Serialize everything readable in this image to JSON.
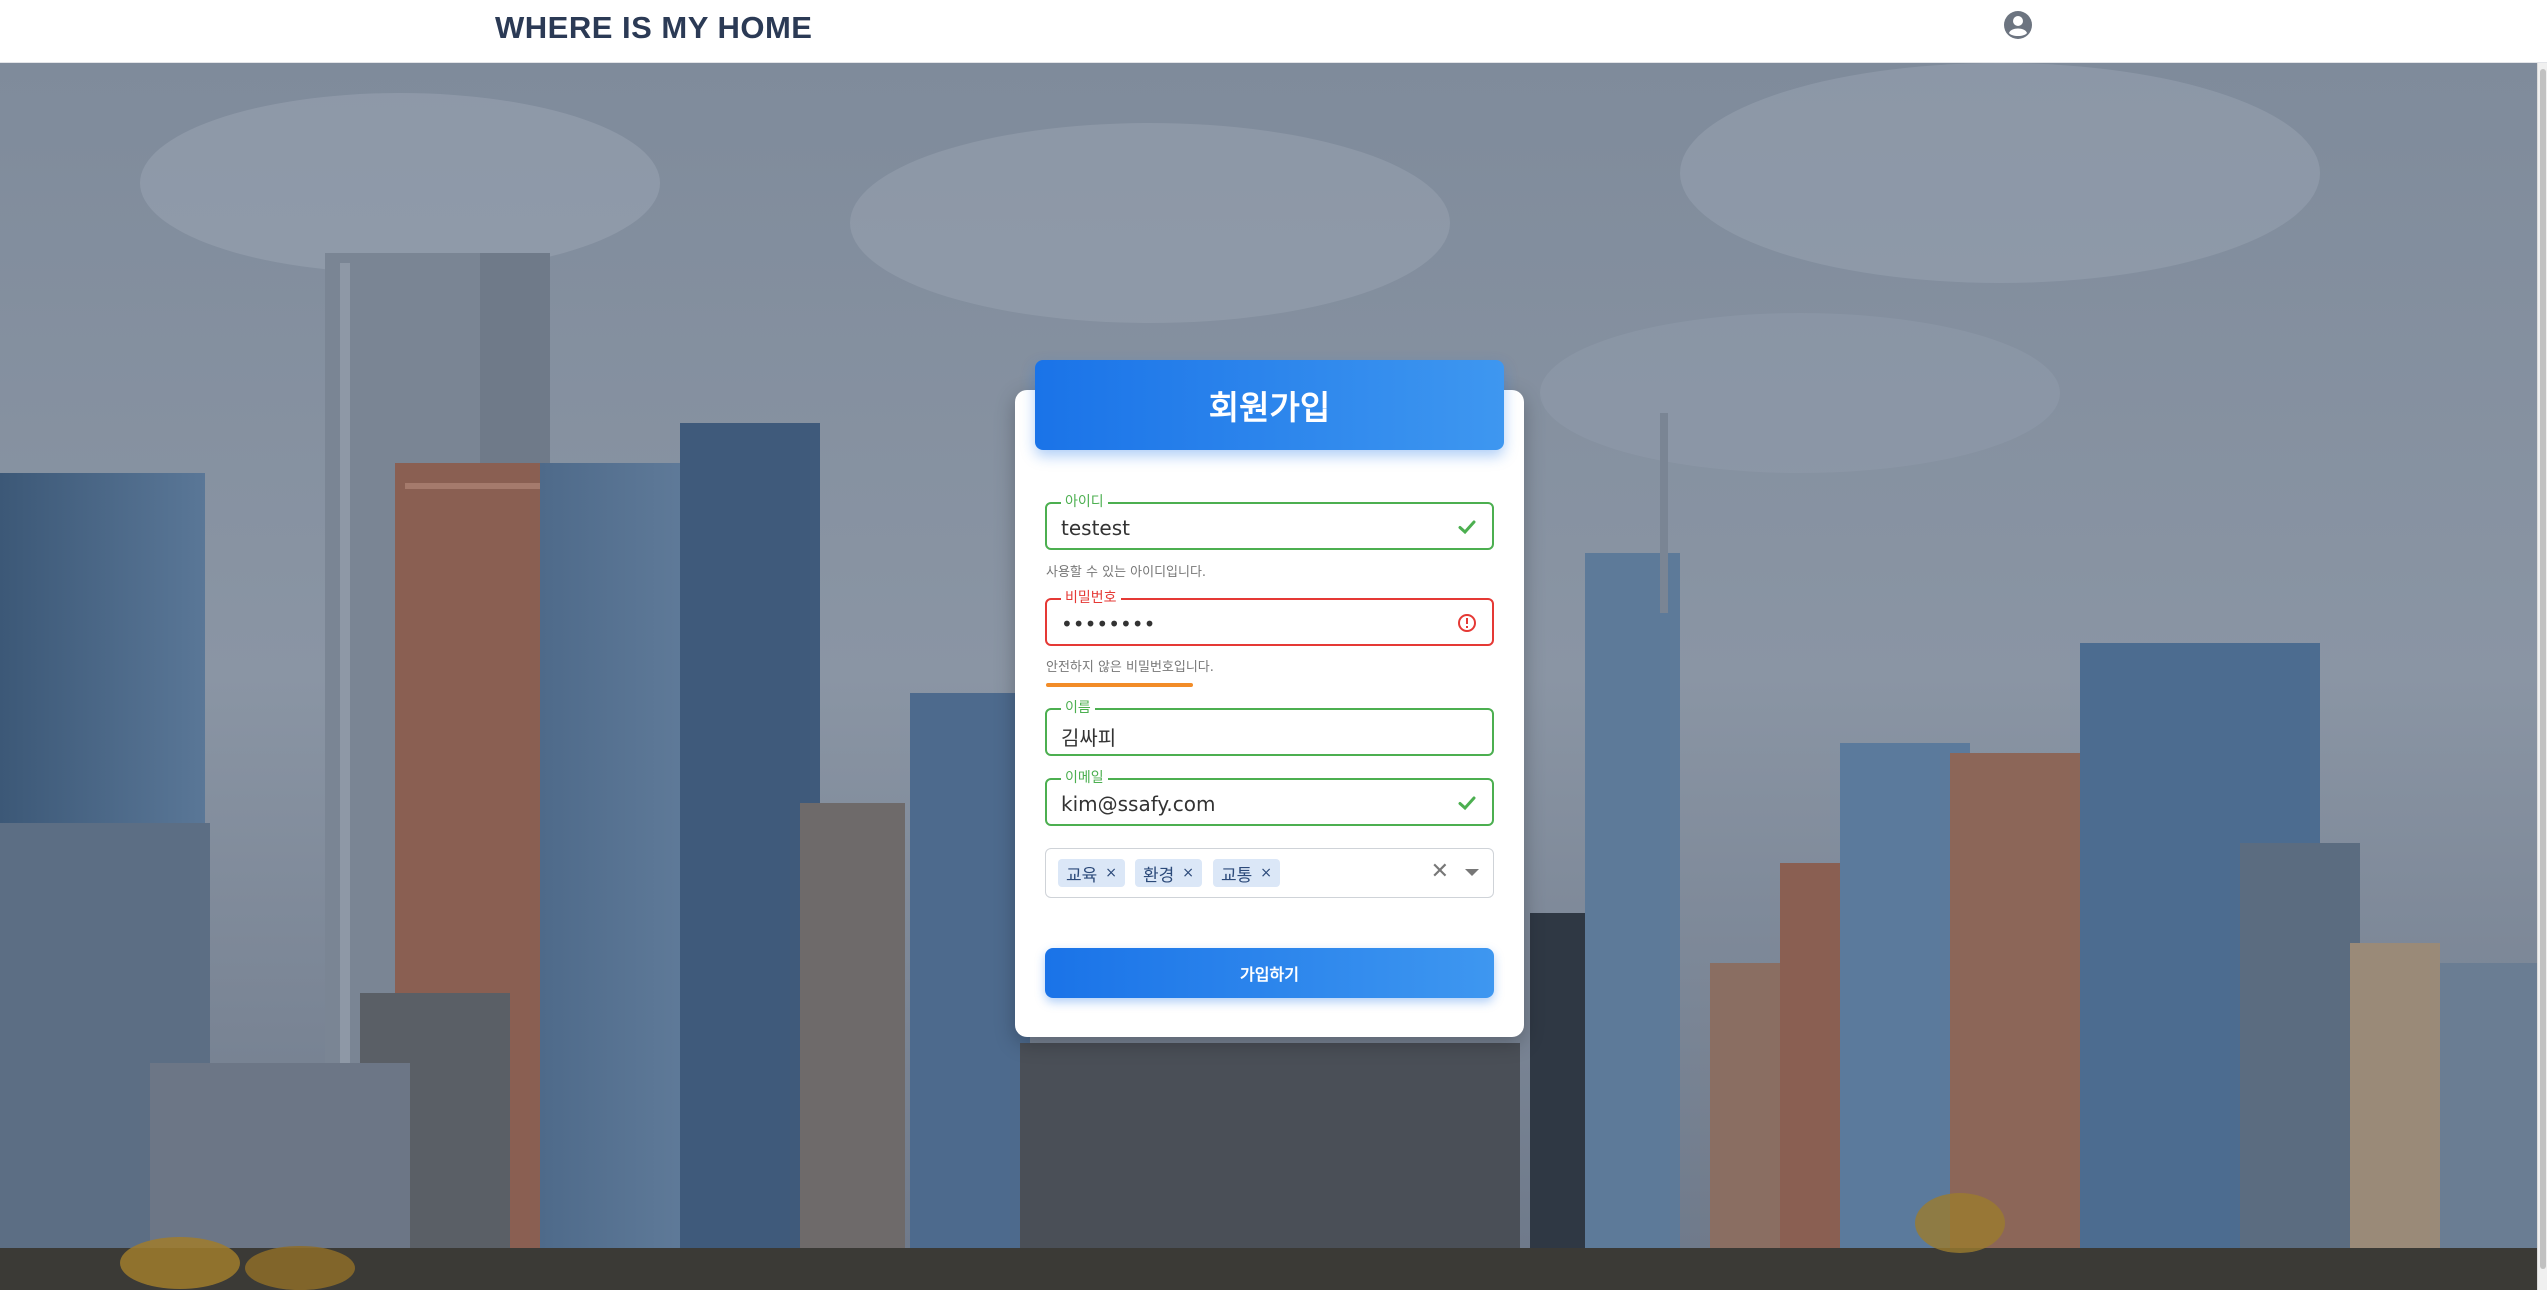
{
  "nav": {
    "brand": "WHERE IS MY HOME",
    "account_icon": "account-circle-icon"
  },
  "signup": {
    "title": "회원가입",
    "fields": {
      "id": {
        "label": "아이디",
        "value": "testest",
        "helper": "사용할 수 있는 아이디입니다.",
        "status": "valid"
      },
      "password": {
        "label": "비밀번호",
        "value": "••••••••",
        "helper": "안전하지 않은 비밀번호입니다.",
        "status": "error"
      },
      "name": {
        "label": "이름",
        "value": "김싸피",
        "status": "valid"
      },
      "email": {
        "label": "이메일",
        "value": "kim@ssafy.com",
        "status": "valid"
      }
    },
    "interests": {
      "tags": [
        "교육",
        "환경",
        "교통"
      ],
      "remove_glyph": "×",
      "clear_glyph": "✕"
    },
    "submit_label": "가입하기"
  },
  "colors": {
    "accent": "#1a73e8",
    "valid": "#4caf50",
    "error": "#e53935",
    "strength_bar": "#f28c28",
    "chip_bg": "#dbe7f7",
    "brand_text": "#2b3a55"
  }
}
